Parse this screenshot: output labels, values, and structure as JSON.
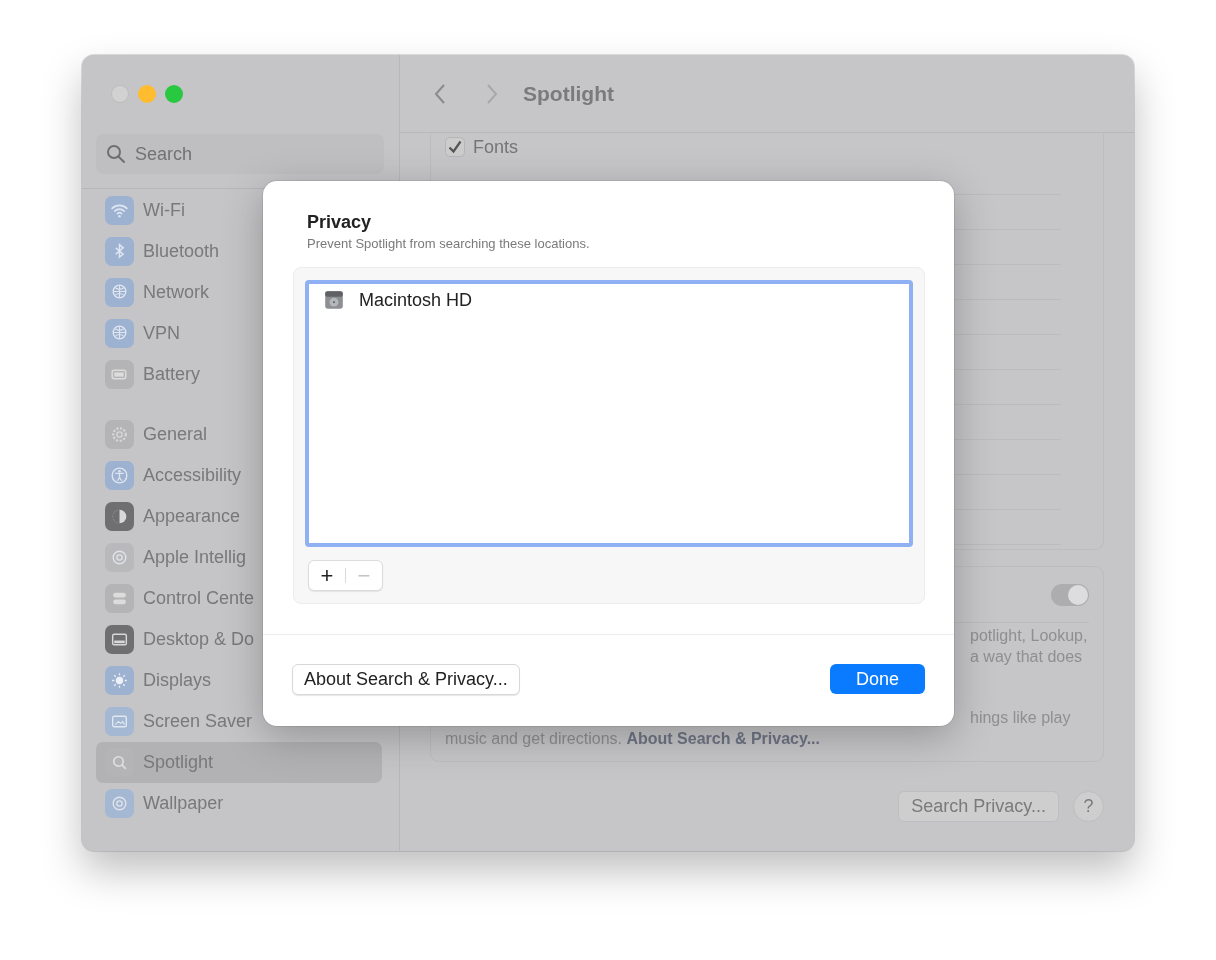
{
  "sidebar": {
    "search": {
      "placeholder": "Search"
    },
    "groups": [
      [
        {
          "label": "Wi-Fi",
          "color": "#9db1d0",
          "selected": false
        },
        {
          "label": "Bluetooth",
          "color": "#9db1d0",
          "selected": false
        },
        {
          "label": "Network",
          "color": "#9db1d0",
          "selected": false
        },
        {
          "label": "VPN",
          "color": "#9db1d0",
          "selected": false
        },
        {
          "label": "Battery",
          "color": "#b4b4b6",
          "selected": false
        }
      ],
      [
        {
          "label": "General",
          "color": "#b4b4b6",
          "selected": false
        },
        {
          "label": "Accessibility",
          "color": "#9db1d0",
          "selected": false
        },
        {
          "label": "Appearance",
          "color": "#6f6f71",
          "selected": false
        },
        {
          "label": "Apple Intellig",
          "color": "#b9b9bc",
          "selected": false
        },
        {
          "label": "Control Cente",
          "color": "#b4b4b6",
          "selected": false
        },
        {
          "label": "Desktop & Do",
          "color": "#6f6f71",
          "selected": false
        },
        {
          "label": "Displays",
          "color": "#9db1d0",
          "selected": false
        },
        {
          "label": "Screen Saver",
          "color": "#a5b8d3",
          "selected": false
        },
        {
          "label": "Spotlight",
          "color": "#b4b4b6",
          "selected": true
        },
        {
          "label": "Wallpaper",
          "color": "#a5b8d3",
          "selected": false
        }
      ]
    ]
  },
  "header": {
    "title": "Spotlight"
  },
  "categories": [
    {
      "label": "Fonts",
      "checked": true
    }
  ],
  "suggestions": {
    "on": true,
    "lines": [
      "potlight, Lookup,",
      "a way that does",
      "hings like play"
    ],
    "last_line": {
      "text": "music and get directions.",
      "link": "About Search & Privacy..."
    }
  },
  "footer_buttons": {
    "privacy": "Search Privacy...",
    "help": "?"
  },
  "sheet": {
    "title": "Privacy",
    "subtitle": "Prevent Spotlight from searching these locations.",
    "locations": [
      {
        "name": "Macintosh HD"
      }
    ],
    "add": {
      "label": "+",
      "disabled": false
    },
    "remove": {
      "label": "−",
      "disabled": true
    },
    "about_button": "About Search & Privacy...",
    "done_button": "Done"
  }
}
